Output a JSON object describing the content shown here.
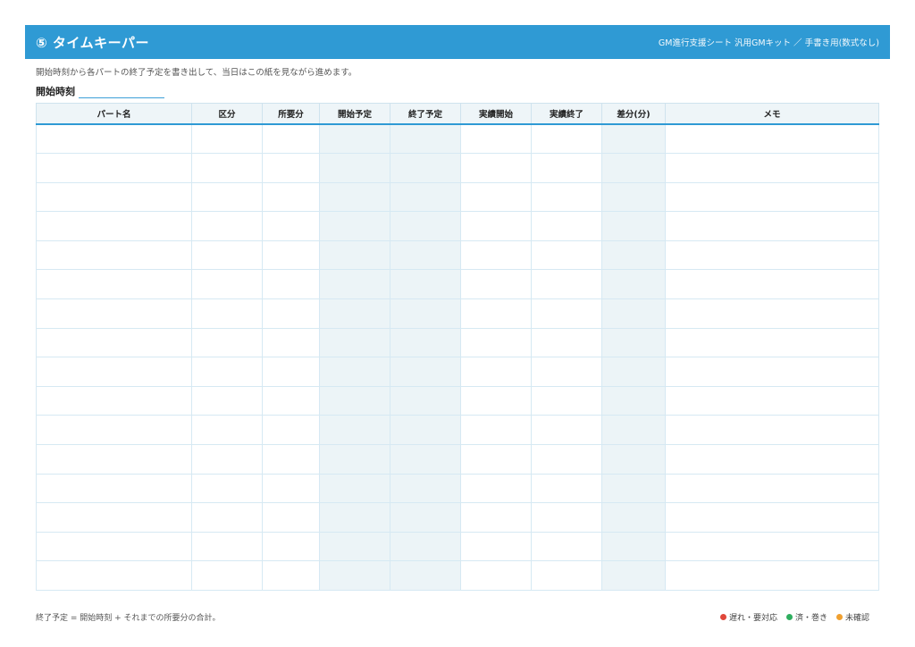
{
  "header": {
    "title": "⑤ タイムキーパー",
    "subtitle": "GM進行支援シート 汎用GMキット ／ 手書き用(数式なし)"
  },
  "instruction": "開始時刻から各パートの終了予定を書き出して、当日はこの紙を見ながら進めます。",
  "start_time_label": "開始時刻",
  "table": {
    "columns": [
      "パート名",
      "区分",
      "所要分",
      "開始予定",
      "終了予定",
      "実績開始",
      "実績終了",
      "差分(分)",
      "メモ"
    ],
    "shaded_columns": [
      3,
      4,
      7
    ],
    "row_count": 16
  },
  "footnote": "終了予定 = 開始時刻 + それまでの所要分の合計。",
  "legend": [
    {
      "label": "遅れ・要対応",
      "color": "#e0473a"
    },
    {
      "label": "済・巻き",
      "color": "#2fae5f"
    },
    {
      "label": "未確認",
      "color": "#f0a030"
    }
  ]
}
